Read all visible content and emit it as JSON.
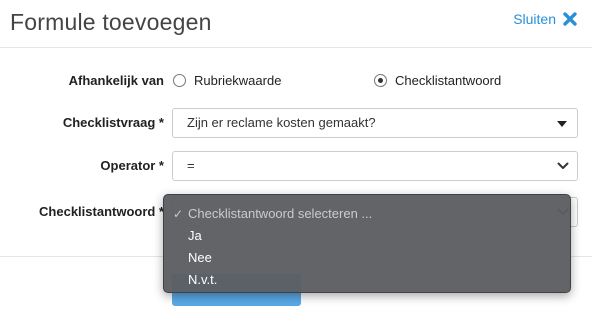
{
  "header": {
    "title": "Formule toevoegen",
    "close_label": "Sluiten"
  },
  "form": {
    "afhankelijk": {
      "label": "Afhankelijk van",
      "options": [
        {
          "label": "Rubriekwaarde",
          "checked": false
        },
        {
          "label": "Checklistantwoord",
          "checked": true
        }
      ]
    },
    "checklistvraag": {
      "label": "Checklistvraag *",
      "value": "Zijn er reclame kosten gemaakt?"
    },
    "operator": {
      "label": "Operator *",
      "value": "="
    },
    "checklistantwoord": {
      "label": "Checklistantwoord *"
    }
  },
  "dropdown": {
    "checkmark": "✓",
    "items": [
      {
        "label": "Checklistantwoord selecteren ...",
        "placeholder": true
      },
      {
        "label": "Ja"
      },
      {
        "label": "Nee"
      },
      {
        "label": "N.v.t."
      }
    ]
  },
  "colors": {
    "accent": "#2a8fd8",
    "button": "#5aa9e6",
    "dropdown_bg": "#5c5e61"
  }
}
